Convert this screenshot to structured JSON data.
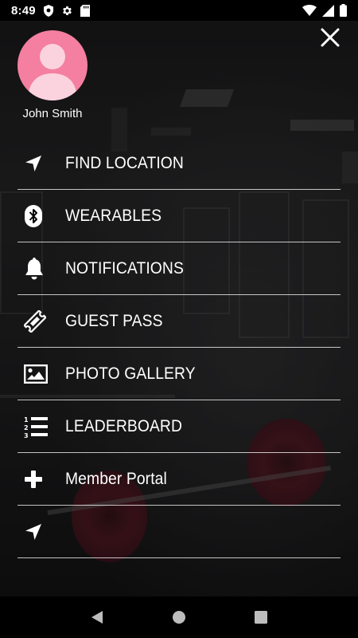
{
  "status_bar": {
    "time": "8:49",
    "left_icons": [
      "shield-icon",
      "gear-icon",
      "sd-card-icon"
    ],
    "right_icons": [
      "wifi-icon",
      "cellular-signal-icon",
      "battery-icon"
    ]
  },
  "profile": {
    "name": "John Smith",
    "avatar_color": "#f47fa0"
  },
  "menu": {
    "items": [
      {
        "label": "FIND LOCATION",
        "icon": "location-arrow-icon"
      },
      {
        "label": "WEARABLES",
        "icon": "bluetooth-icon"
      },
      {
        "label": "NOTIFICATIONS",
        "icon": "bell-icon"
      },
      {
        "label": "GUEST PASS",
        "icon": "ticket-icon"
      },
      {
        "label": "PHOTO GALLERY",
        "icon": "image-icon"
      },
      {
        "label": "LEADERBOARD",
        "icon": "numbered-list-icon"
      },
      {
        "label": "Member Portal",
        "icon": "plus-icon"
      },
      {
        "label": "",
        "icon": "location-arrow-icon"
      }
    ]
  },
  "nav_bar": {
    "buttons": [
      "back-icon",
      "home-icon",
      "recents-icon"
    ]
  }
}
